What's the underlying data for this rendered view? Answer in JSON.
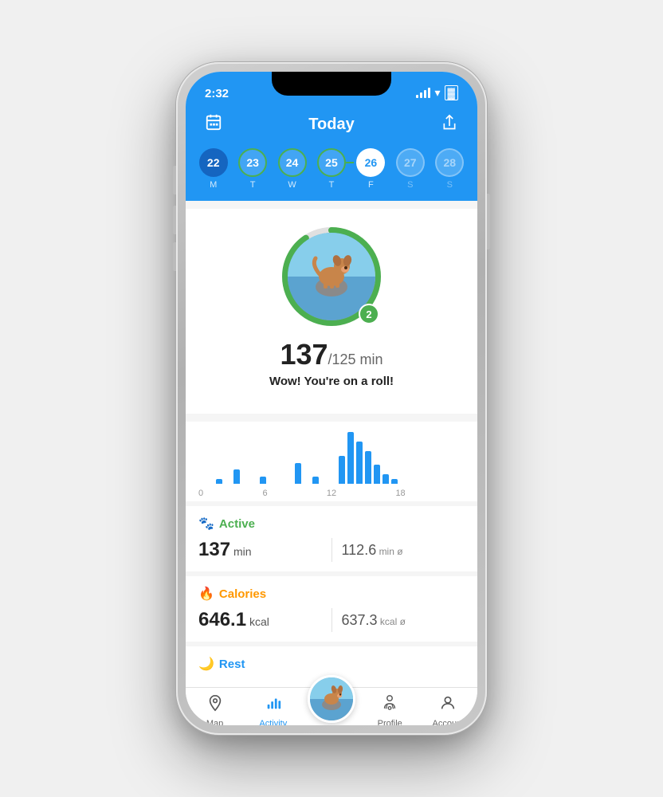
{
  "status": {
    "time": "2:32"
  },
  "header": {
    "title": "Today",
    "calendar_icon": "📅",
    "share_icon": "⬆"
  },
  "dates": [
    {
      "number": "22",
      "day": "M",
      "style": "blue-solid"
    },
    {
      "number": "23",
      "day": "T",
      "style": "green-ring"
    },
    {
      "number": "24",
      "day": "W",
      "style": "green-ring"
    },
    {
      "number": "25",
      "day": "T",
      "style": "green-ring"
    },
    {
      "number": "26",
      "day": "F",
      "style": "active"
    },
    {
      "number": "27",
      "day": "S",
      "style": "future"
    },
    {
      "number": "28",
      "day": "S",
      "style": "future"
    }
  ],
  "profile": {
    "minutes_achieved": "137",
    "minutes_goal": "125",
    "minutes_label": "/125 min",
    "motivation": "Wow! You're on a roll!",
    "badge_count": "2"
  },
  "chart": {
    "bars": [
      0,
      0,
      5,
      0,
      15,
      0,
      0,
      8,
      0,
      0,
      0,
      22,
      0,
      8,
      0,
      0,
      30,
      55,
      45,
      35,
      20,
      10,
      5,
      0
    ],
    "labels": [
      "0",
      "6",
      "12",
      "18"
    ]
  },
  "stats": {
    "active": {
      "icon": "🐾",
      "label": "Active",
      "value": "137",
      "unit": "min",
      "avg": "112.6",
      "avg_unit": "min ø"
    },
    "calories": {
      "icon": "🔥",
      "label": "Calories",
      "value": "646.1",
      "unit": "kcal",
      "avg": "637.3",
      "avg_unit": "kcal ø"
    },
    "rest": {
      "icon": "🌙",
      "label": "Rest"
    }
  },
  "nav": {
    "items": [
      {
        "label": "Map",
        "icon": "📍",
        "active": false
      },
      {
        "label": "Activity",
        "icon": "📊",
        "active": true
      },
      {
        "label": "Profile",
        "icon": "🐾",
        "active": false
      },
      {
        "label": "Account",
        "icon": "👤",
        "active": false
      }
    ]
  }
}
